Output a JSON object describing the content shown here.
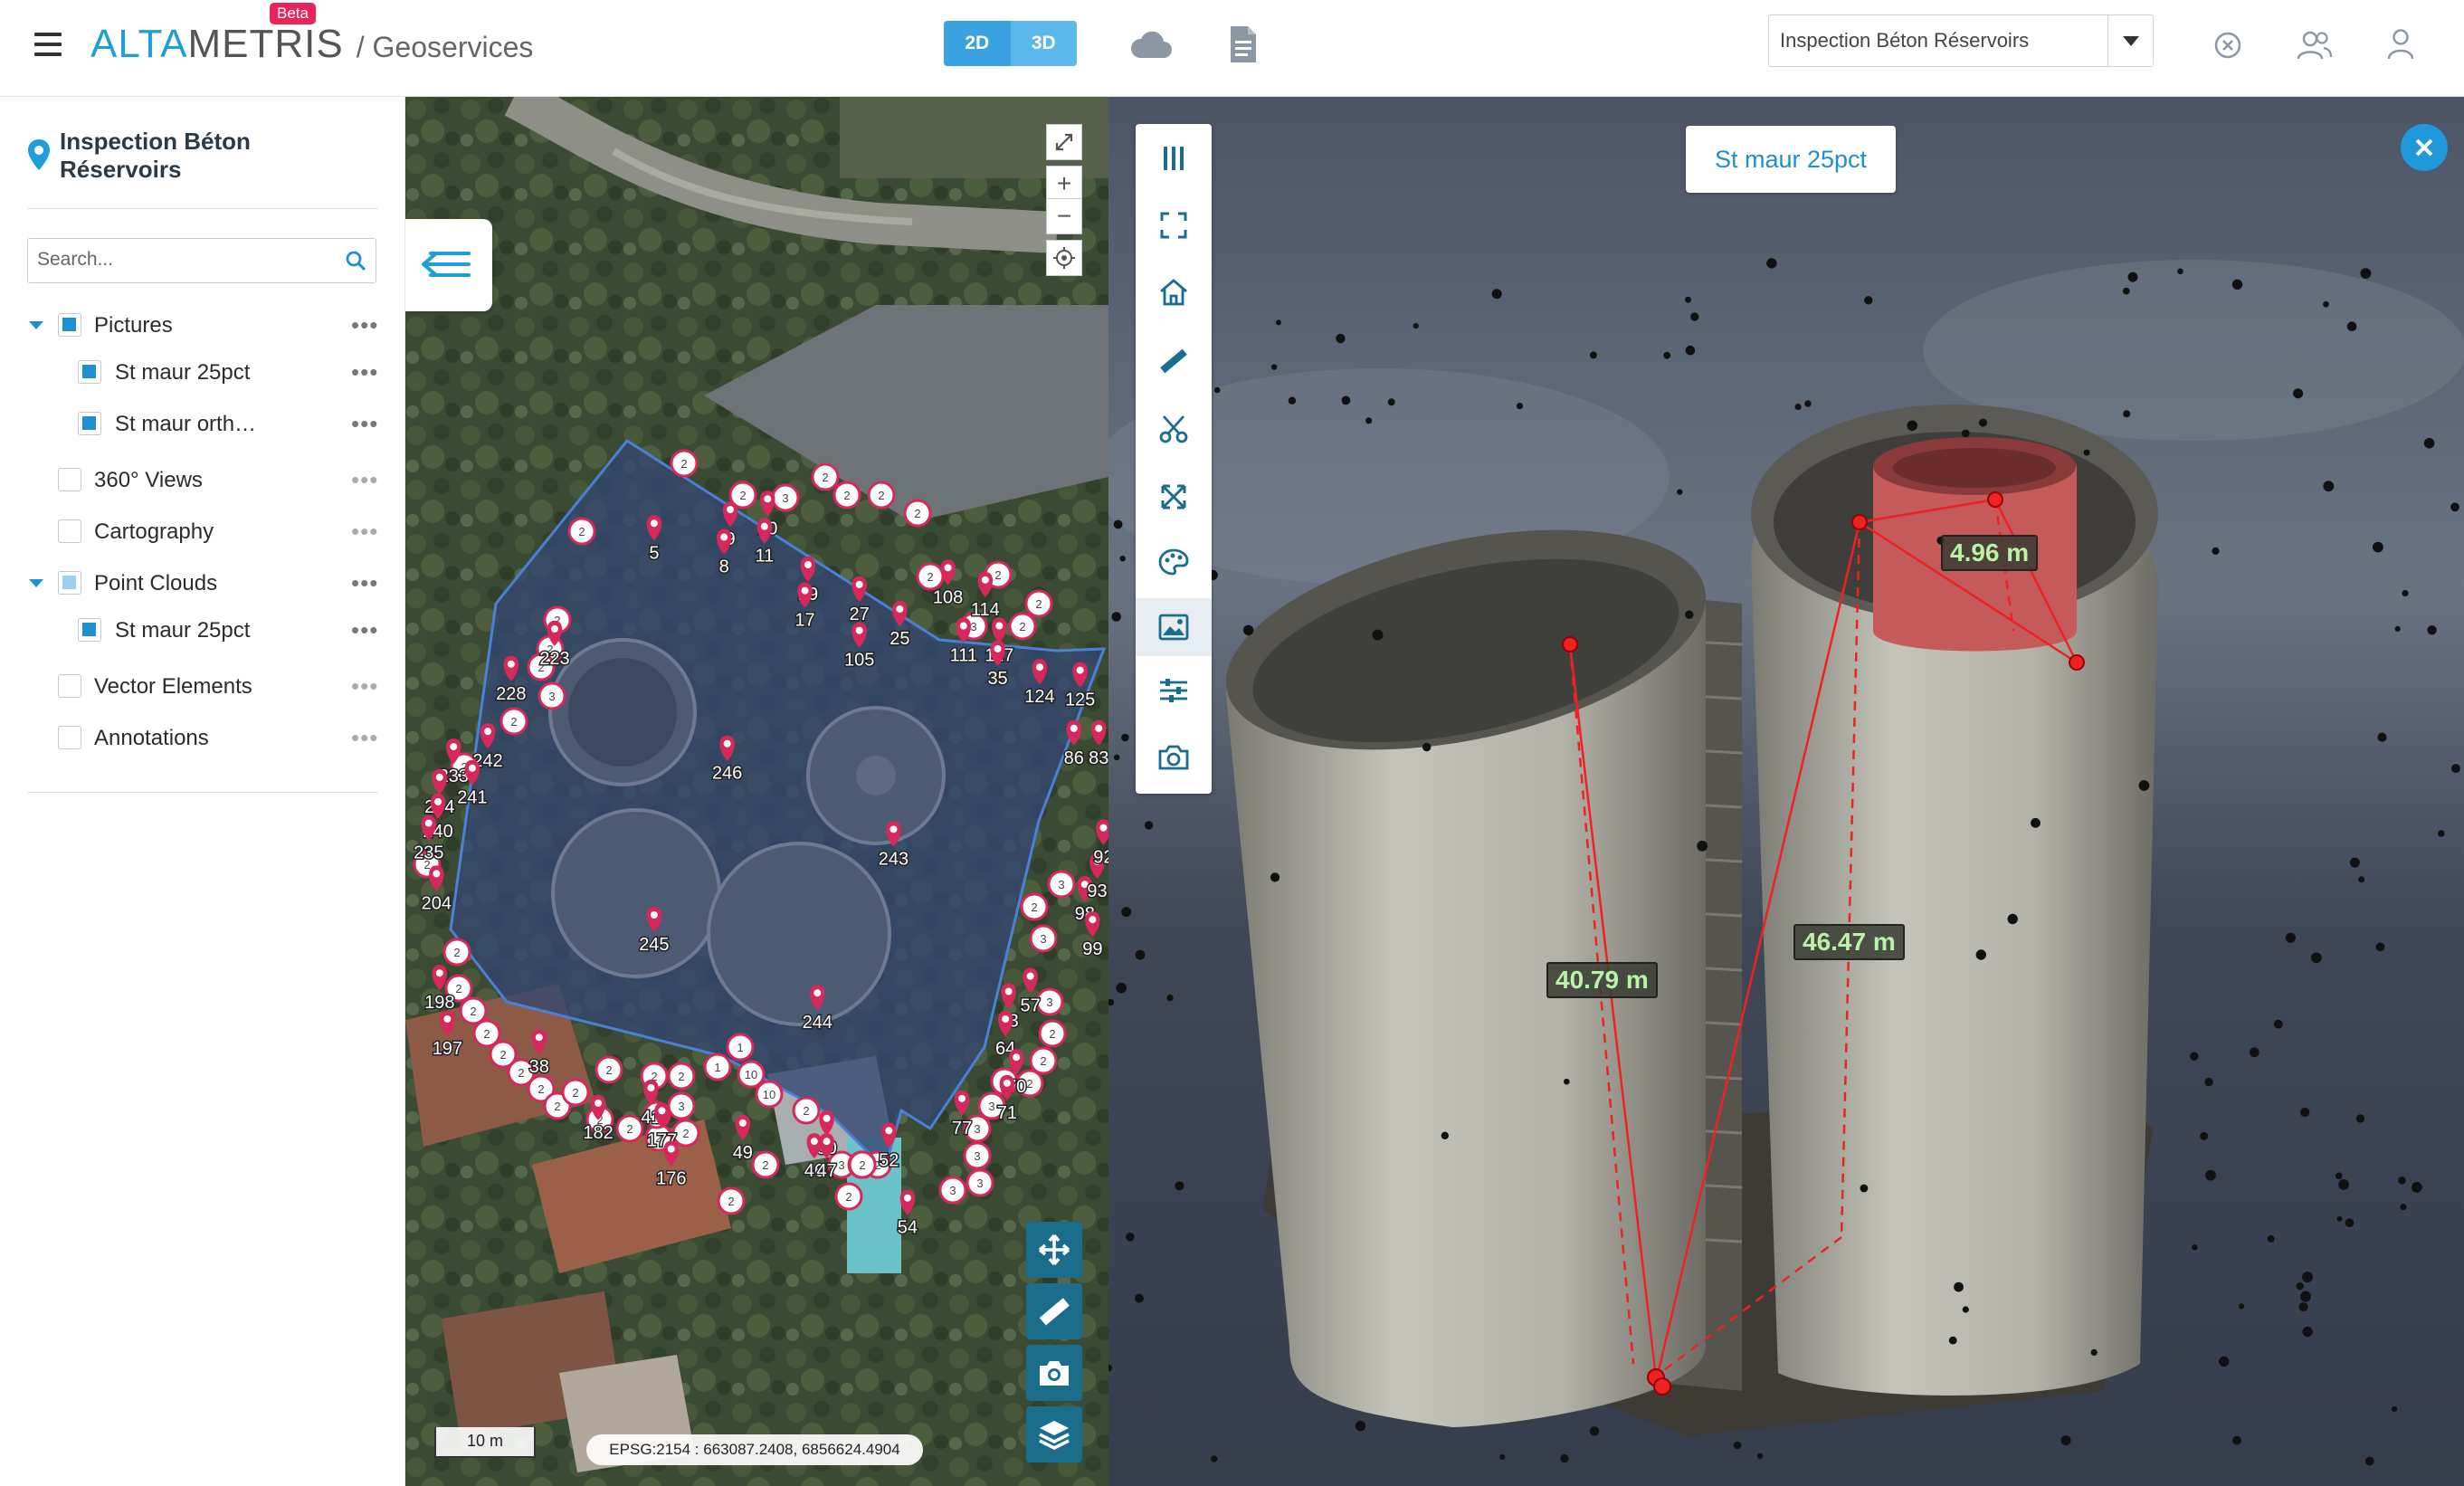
{
  "app": {
    "brand_alta": "ALTA",
    "brand_metris": "METRIS",
    "brand_separator": "/ Geoservices",
    "beta_badge": "Beta"
  },
  "view_toggle": {
    "options": [
      "2D",
      "3D"
    ],
    "active": "2D"
  },
  "project_select": {
    "value": "Inspection Béton Réservoirs"
  },
  "sidebar": {
    "project_title": "Inspection Béton Réservoirs",
    "search_placeholder": "Search...",
    "tree": [
      {
        "label": "Pictures",
        "state": "checked",
        "expanded": true,
        "level": 0
      },
      {
        "label": "St maur 25pct",
        "state": "checked",
        "level": 1
      },
      {
        "label": "St maur orth…",
        "state": "checked",
        "level": 1
      },
      {
        "label": "360° Views",
        "state": "unchecked",
        "level": 0
      },
      {
        "label": "Cartography",
        "state": "unchecked",
        "level": 0
      },
      {
        "label": "Point Clouds",
        "state": "partial",
        "expanded": true,
        "level": 0
      },
      {
        "label": "St maur 25pct",
        "state": "checked",
        "level": 1
      },
      {
        "label": "Vector Elements",
        "state": "unchecked",
        "level": 0
      },
      {
        "label": "Annotations",
        "state": "unchecked",
        "level": 0
      }
    ],
    "more_label": "•••"
  },
  "map2d": {
    "zoom_in": "+",
    "zoom_out": "−",
    "scale_label": "10 m",
    "coords_label": "EPSG:2154 : 663087.2408, 6856624.4904",
    "cluster_label": "2",
    "markers": [
      "5",
      "9",
      "8",
      "10",
      "11",
      "29",
      "17",
      "27",
      "25",
      "105",
      "108",
      "114",
      "111",
      "117",
      "35",
      "124",
      "125",
      "86",
      "83",
      "223",
      "228",
      "242",
      "233",
      "241",
      "234",
      "240",
      "235",
      "204",
      "198",
      "197",
      "38",
      "182",
      "41",
      "177",
      "176",
      "49",
      "50",
      "46",
      "47",
      "52",
      "54",
      "77",
      "57",
      "63",
      "64",
      "70",
      "71",
      "98",
      "99",
      "93",
      "92",
      "246",
      "243",
      "245",
      "244"
    ]
  },
  "view3d": {
    "cloud_name": "St maur 25pct",
    "measurements": [
      "4.96 m",
      "40.79 m",
      "46.47 m"
    ]
  },
  "colors": {
    "brand_blue": "#1e9fd8",
    "accent": "#1e8fd0",
    "marker": "#d6285a",
    "map_tool": "#1a6e8c",
    "measure_text": "#b9f2a8"
  }
}
